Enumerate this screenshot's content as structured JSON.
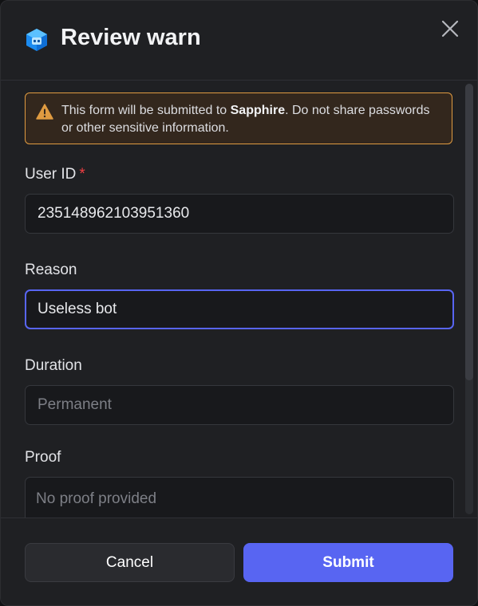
{
  "dialog": {
    "title": "Review warn",
    "close_icon": "close-icon",
    "app_icon": "cube-logo-icon",
    "brand_color": "#5865f2",
    "warning_color": "#e09b41"
  },
  "notice": {
    "icon": "warning-triangle-icon",
    "text_before": "This form will be submitted to ",
    "app_name": "Sapphire",
    "text_after": ". Do not share passwords or other sensitive information."
  },
  "form": {
    "user_id": {
      "label": "User ID",
      "required_mark": "*",
      "value": "235148962103951360"
    },
    "reason": {
      "label": "Reason",
      "value": "Useless bot"
    },
    "duration": {
      "label": "Duration",
      "placeholder": "Permanent"
    },
    "proof": {
      "label": "Proof",
      "placeholder": "No proof provided"
    }
  },
  "footer": {
    "cancel_label": "Cancel",
    "submit_label": "Submit"
  }
}
